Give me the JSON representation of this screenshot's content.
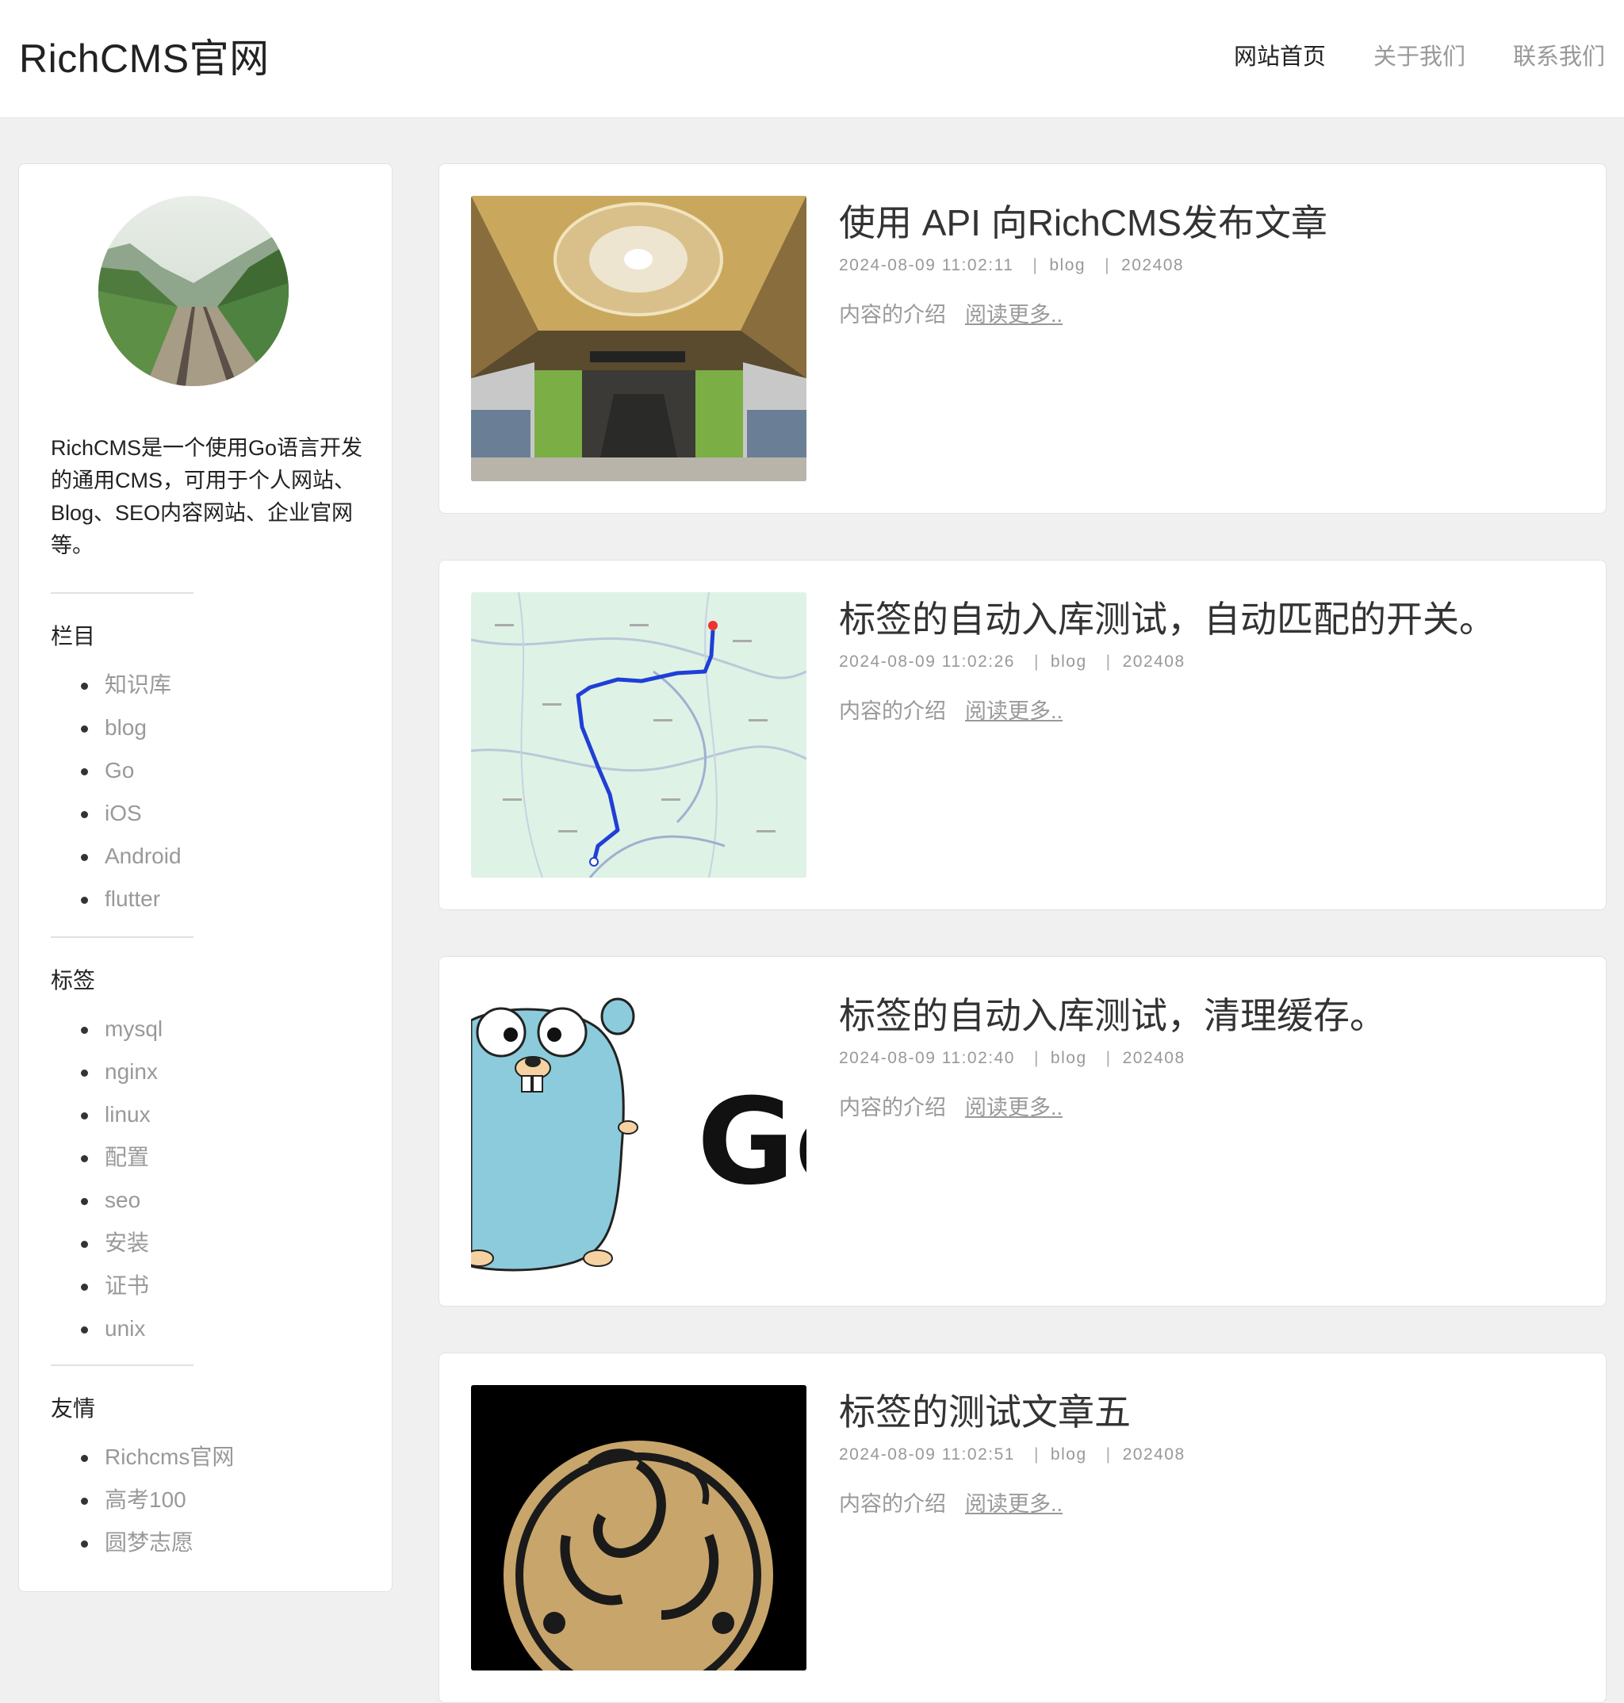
{
  "header": {
    "brand": "RichCMS官网",
    "nav": [
      {
        "label": "网站首页",
        "active": true
      },
      {
        "label": "关于我们",
        "active": false
      },
      {
        "label": "联系我们",
        "active": false
      }
    ]
  },
  "sidebar": {
    "intro": "RichCMS是一个使用Go语言开发的通用CMS，可用于个人网站、Blog、SEO内容网站、企业官网等。",
    "sections": [
      {
        "title": "栏目",
        "items": [
          "知识库",
          "blog",
          "Go",
          "iOS",
          "Android",
          "flutter"
        ]
      },
      {
        "title": "标签",
        "items": [
          "mysql",
          "nginx",
          "linux",
          "配置",
          "seo",
          "安装",
          "证书",
          "unix"
        ]
      },
      {
        "title": "友情",
        "items": [
          "Richcms官网",
          "高考100",
          "圆梦志愿"
        ]
      }
    ]
  },
  "posts": [
    {
      "title": "使用 API 向RichCMS发布文章",
      "date": "2024-08-09 11:02:11",
      "category": "blog",
      "archive": "202408",
      "excerpt": "内容的介绍",
      "more": "阅读更多..",
      "thumb": "subway-station-image"
    },
    {
      "title": "标签的自动入库测试，自动匹配的开关。",
      "date": "2024-08-09 11:02:26",
      "category": "blog",
      "archive": "202408",
      "excerpt": "内容的介绍",
      "more": "阅读更多..",
      "thumb": "route-map-image"
    },
    {
      "title": "标签的自动入库测试，清理缓存。",
      "date": "2024-08-09 11:02:40",
      "category": "blog",
      "archive": "202408",
      "excerpt": "内容的介绍",
      "more": "阅读更多..",
      "thumb": "go-gopher-image"
    },
    {
      "title": "标签的测试文章五",
      "date": "2024-08-09 11:02:51",
      "category": "blog",
      "archive": "202408",
      "excerpt": "内容的介绍",
      "more": "阅读更多..",
      "thumb": "ornament-image"
    }
  ],
  "colors": {
    "accent": "#222222",
    "muted": "#999999",
    "background": "#f0f0f0",
    "card": "#ffffff"
  }
}
